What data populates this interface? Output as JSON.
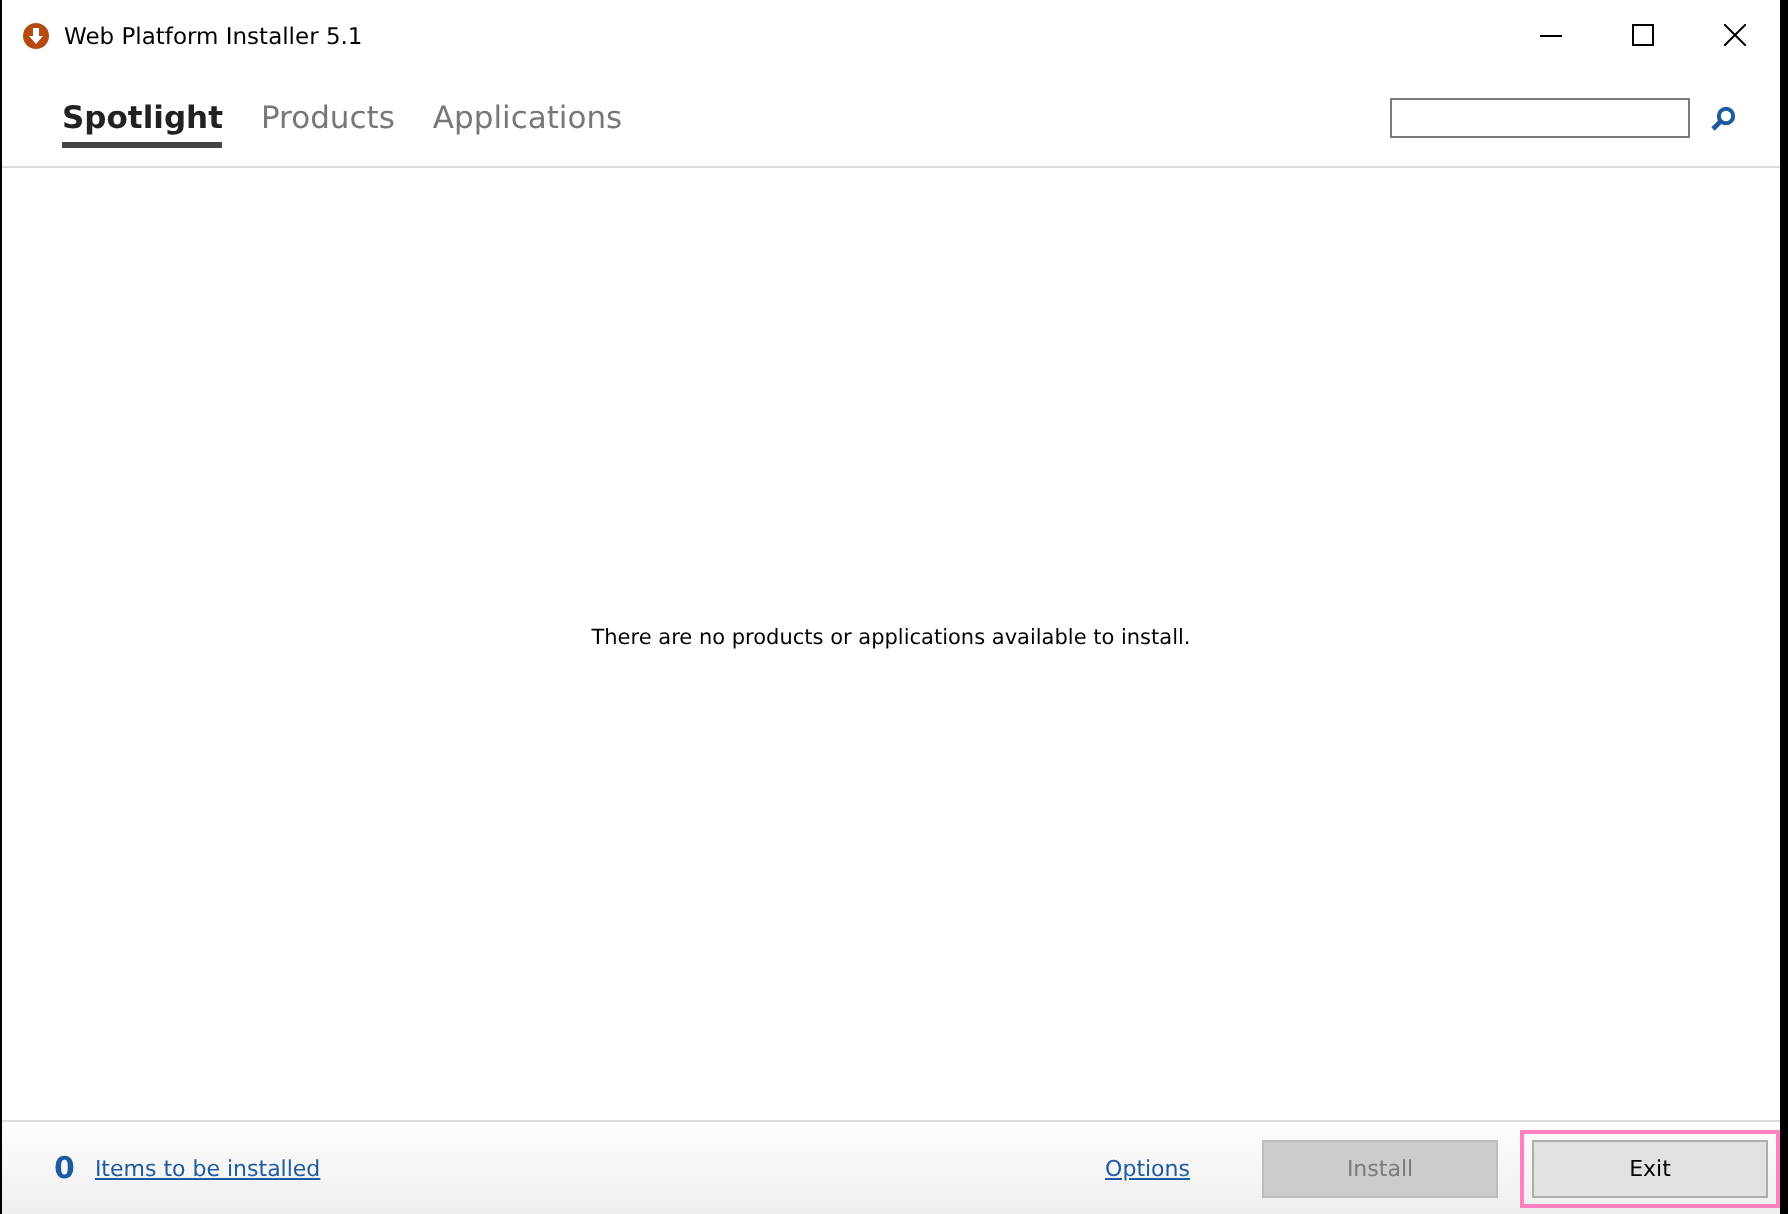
{
  "window": {
    "title": "Web Platform Installer 5.1"
  },
  "tabs": [
    {
      "label": "Spotlight",
      "selected": true
    },
    {
      "label": "Products",
      "selected": false
    },
    {
      "label": "Applications",
      "selected": false
    }
  ],
  "message": "There are no products or applications available to install.",
  "footer": {
    "count": "0",
    "items_link": "Items to be installed",
    "options_link": "Options",
    "buttons": [
      {
        "label": "Install",
        "disabled": true,
        "highlighted": false
      },
      {
        "label": "Exit",
        "disabled": false,
        "highlighted": true
      }
    ]
  }
}
